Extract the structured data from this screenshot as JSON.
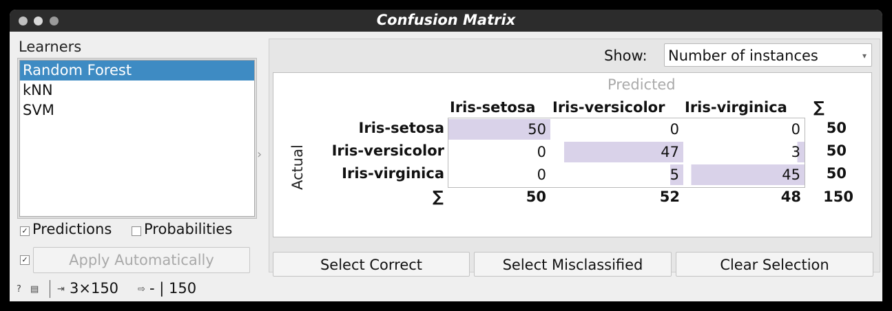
{
  "window": {
    "title": "Confusion Matrix"
  },
  "learners": {
    "label": "Learners",
    "items": [
      "Random Forest",
      "kNN",
      "SVM"
    ],
    "selected_index": 0
  },
  "options": {
    "predictions_label": "Predictions",
    "predictions_checked": true,
    "probabilities_label": "Probabilities",
    "probabilities_checked": false,
    "auto_checked": true,
    "apply_label": "Apply Automatically"
  },
  "status": {
    "input_summary": "3×150",
    "output_summary": "- | 150"
  },
  "show": {
    "label": "Show:",
    "value": "Number of instances"
  },
  "matrix": {
    "predicted_label": "Predicted",
    "actual_label": "Actual",
    "sum_symbol": "∑",
    "classes": [
      "Iris-setosa",
      "Iris-versicolor",
      "Iris-virginica"
    ],
    "rows": [
      {
        "label": "Iris-setosa",
        "values": [
          "50",
          "0",
          "0"
        ],
        "total": "50"
      },
      {
        "label": "Iris-versicolor",
        "values": [
          "0",
          "47",
          "3"
        ],
        "total": "50"
      },
      {
        "label": "Iris-virginica",
        "values": [
          "0",
          "5",
          "45"
        ],
        "total": "50"
      }
    ],
    "col_totals": [
      "50",
      "52",
      "48"
    ],
    "grand_total": "150",
    "shade_fraction": [
      [
        1.0,
        0,
        0
      ],
      [
        0,
        0.904,
        0.058
      ],
      [
        0,
        0.104,
        0.938
      ]
    ],
    "shade_color": "#d9d2e9"
  },
  "buttons": {
    "select_correct": "Select Correct",
    "select_misclassified": "Select Misclassified",
    "clear_selection": "Clear Selection"
  }
}
